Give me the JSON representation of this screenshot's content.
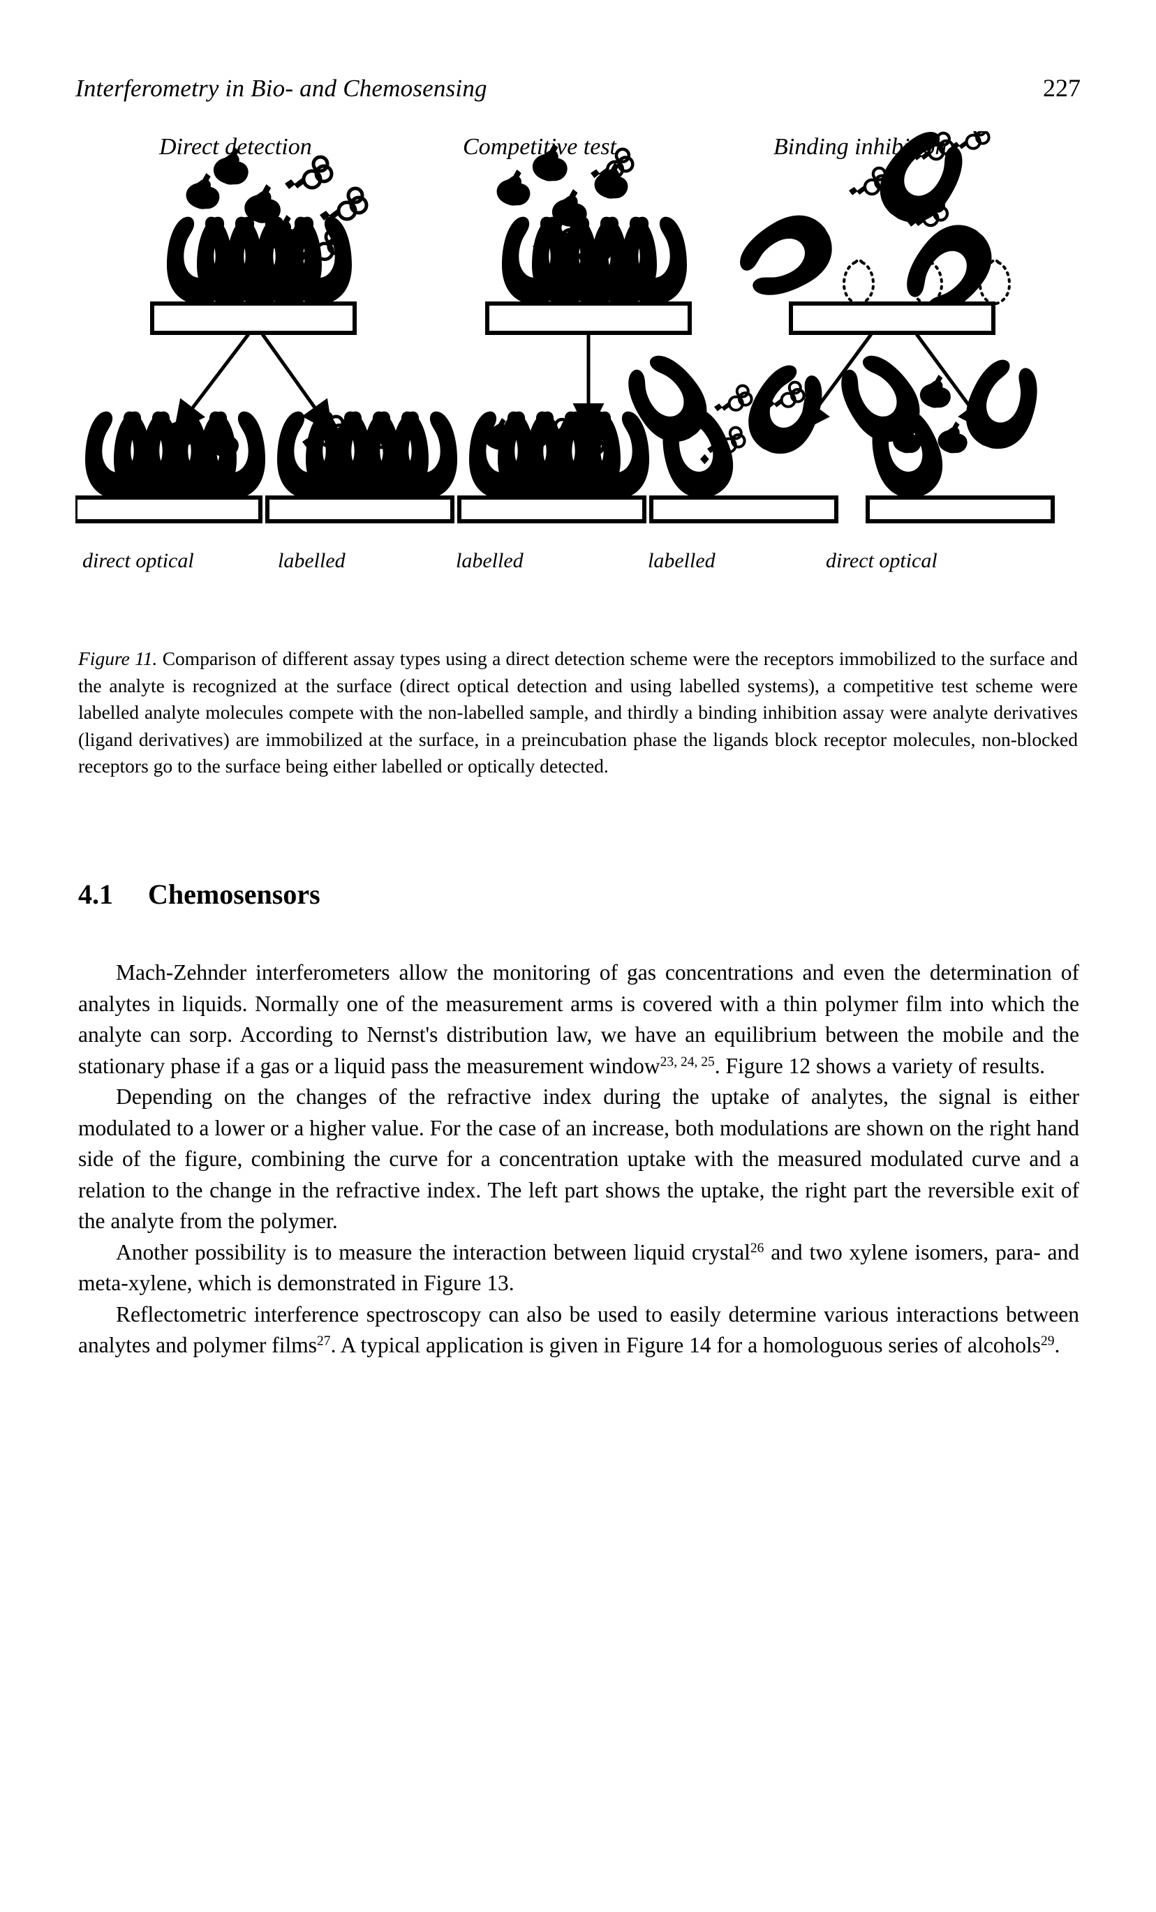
{
  "running_head": {
    "title": "Interferometry in Bio- and Chemosensing",
    "page_number": "227"
  },
  "figure": {
    "name": "figure-11",
    "column_titles": [
      "Direct detection",
      "Competitive test",
      "Binding inhibition"
    ],
    "bottom_labels": [
      "direct optical",
      "labelled",
      "labelled",
      "labelled",
      "direct optical"
    ],
    "caption_label": "Figure 11.",
    "caption_text": " Comparison of different assay types using a direct detection scheme were the receptors immobilized to the surface and the analyte is recognized at the surface (direct optical detection and using labelled systems), a competitive test scheme were labelled analyte molecules compete with the non-labelled sample, and thirdly a binding inhibition assay were analyte derivatives (ligand derivatives) are immobilized at the surface, in a preincubation phase the ligands block receptor molecules, non-blocked receptors go to the surface being either labelled or optically detected."
  },
  "section": {
    "number": "4.1",
    "title": "Chemosensors"
  },
  "paragraphs": [
    {
      "id": "para-mach-zehnder",
      "runs": [
        {
          "type": "text",
          "value": "Mach-Zehnder interferometers allow the monitoring of gas concentrations and even the determination of analytes in liquids. Normally one of the measurement arms is covered with a thin polymer film into which the analyte can sorp. According to Nernst's distribution law, we have an equilibrium between the mobile and the stationary phase if a gas or a liquid pass the measurement window"
        },
        {
          "type": "sup",
          "value": "23, 24, 25"
        },
        {
          "type": "text",
          "value": ". Figure 12 shows a variety of results."
        }
      ]
    },
    {
      "id": "para-refractive-index",
      "runs": [
        {
          "type": "text",
          "value": "Depending on the changes of the refractive index during the uptake of analytes, the signal is either modulated to a lower or a higher value. For the case of an increase, both modulations are shown on the right hand side of the figure, combining the curve for a concentration uptake with the measured modulated curve and a relation to the change in the refractive index. The left part shows the uptake, the right part the reversible exit of the analyte from the polymer."
        }
      ]
    },
    {
      "id": "para-liquid-crystal",
      "runs": [
        {
          "type": "text",
          "value": "Another possibility is to measure the interaction between liquid crystal"
        },
        {
          "type": "sup",
          "value": "26"
        },
        {
          "type": "text",
          "value": " and two xylene isomers, para- and meta-xylene, which is demonstrated in Figure 13."
        }
      ]
    },
    {
      "id": "para-reflectometric",
      "runs": [
        {
          "type": "text",
          "value": "Reflectometric interference spectroscopy can also be used to easily determine various interactions between analytes and polymer films"
        },
        {
          "type": "sup",
          "value": "27"
        },
        {
          "type": "text",
          "value": ". A typical application is given in Figure 14 for a homologuous series of alcohols"
        },
        {
          "type": "sup",
          "value": "29"
        },
        {
          "type": "text",
          "value": "."
        }
      ]
    }
  ],
  "colors": {
    "ink": "#000000",
    "paper": "#ffffff"
  }
}
